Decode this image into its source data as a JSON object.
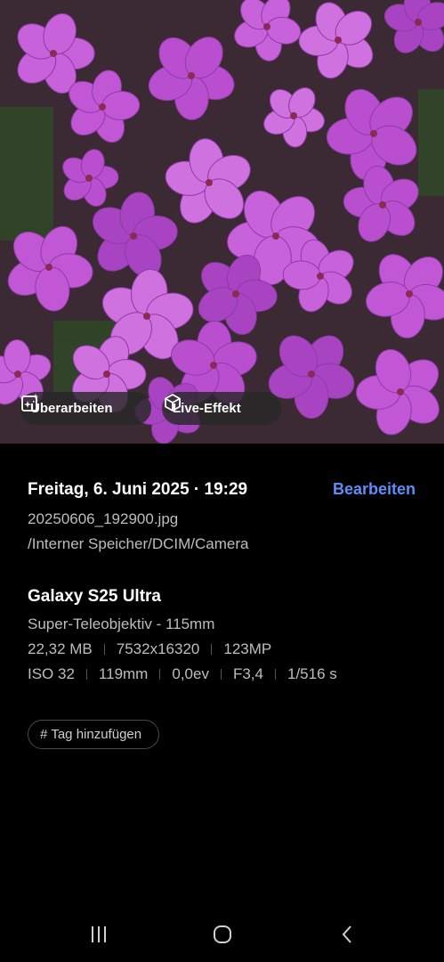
{
  "photo": {
    "actions": {
      "edit_label": "Überarbeiten",
      "live_effect_label": "Live-Effekt"
    }
  },
  "details": {
    "datetime": "Freitag, 6. Juni 2025 · 19:29",
    "edit_link": "Bearbeiten",
    "filename": "20250606_192900.jpg",
    "path": "/Interner Speicher/DCIM/Camera",
    "device": "Galaxy S25 Ultra",
    "lens": "Super-Teleobjektiv - 115mm",
    "file_size": "22,32 MB",
    "resolution": "7532x16320",
    "megapixels": "123MP",
    "iso": "ISO 32",
    "focal_length": "119mm",
    "exposure_value": "0,0ev",
    "aperture": "F3,4",
    "shutter": "1/516 s",
    "add_tag_label": "Tag hinzufügen"
  },
  "navbar": {
    "recent_icon": "recent-apps-icon",
    "home_icon": "home-icon",
    "back_icon": "back-icon"
  },
  "colors": {
    "background": "#000000",
    "accent": "#5e8dfa",
    "secondary_text": "#bdbdbd",
    "flower": "#c05fd8"
  }
}
